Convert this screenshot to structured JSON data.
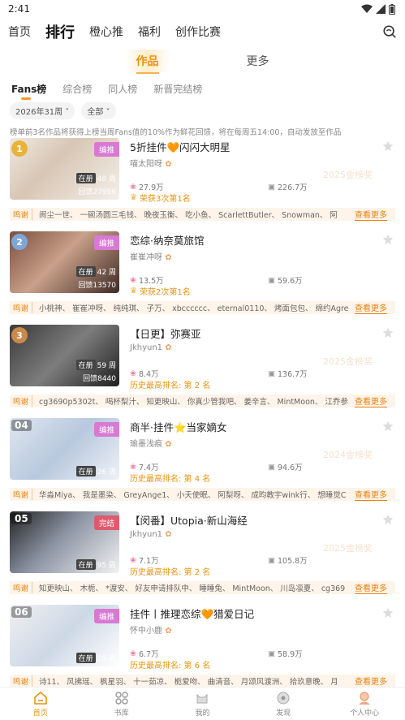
{
  "status": {
    "time": "2:41"
  },
  "nav": {
    "items": [
      "首页",
      "排行",
      "橙心推",
      "福利",
      "创作比赛"
    ],
    "active_index": 1
  },
  "sub_tabs": [
    "作品",
    "更多"
  ],
  "rank_tabs": [
    "Fans榜",
    "综合榜",
    "同人榜",
    "新晋完结榜"
  ],
  "filters": {
    "period": "2026年31周",
    "scope": "全部"
  },
  "notice": "榜单前3名作品将获得上榜当周Fans值的10%作为鲜花回馈，将在每周五14:00，自动发放至作品",
  "thanks_label": "鸣谢",
  "more_label": "查看更多",
  "works": [
    {
      "rank": "1",
      "title": "5折挂件🧡闪闪大明星",
      "author": "喵太阳呀",
      "tag": "编推",
      "shelf": "在册",
      "weeks": "48 周",
      "returns": "回馈27956",
      "fans": "27.9万",
      "collect": "226.7万",
      "honor": "荣获3次第1名",
      "watermark": "2025金榜奖",
      "thanks": "阆尘一世、 一碗汤圆三毛钱、 晚夜玉衡、 吃小鱼、 ScarlettButler、 Snowman、 阿"
    },
    {
      "rank": "2",
      "title": "恋综·纳奈莫旅馆",
      "author": "崔崔冲呀",
      "tag": "编推",
      "shelf": "在册",
      "weeks": "42 周",
      "returns": "回馈13570",
      "fans": "13.5万",
      "collect": "59.6万",
      "honor": "荣获2次第1名",
      "watermark": "",
      "thanks": "小桃神、 崔崔冲呀、 纯纯琪、 子万、 xbcccccc、 eternal0110、 烤面包包、 绵约Agre"
    },
    {
      "rank": "3",
      "title": "【日更】弥赛亚",
      "author": "Jkhyun1",
      "tag": "",
      "shelf": "在册",
      "weeks": "59 周",
      "returns": "回馈8440",
      "fans": "8.4万",
      "collect": "136.7万",
      "honor": "历史最高排名: 第 2 名",
      "watermark": "2025金榜奖",
      "thanks": "cg3690p5302t、 喝杯梨汁、 知更映山、 你真少管我吧、 姜辛言、 MintMoon、 江乔参"
    },
    {
      "rank": "04",
      "title": "商半·挂件⭐当家嫡女",
      "author": "瑜墨浅痕",
      "tag": "编推",
      "shelf": "在册",
      "weeks": "26 周",
      "returns": "",
      "fans": "7.4万",
      "collect": "94.6万",
      "honor": "历史最高排名: 第 4 名",
      "watermark": "2024金榜奖",
      "thanks": "华淼Miya、 我是墨染、 GreyAnge1、 小夭使眠、 阿梨呀、 成昀教宇wink行、 想睡觉C"
    },
    {
      "rank": "05",
      "title": "【闵番】Utopia·新山海经",
      "author": "Jkhyun1",
      "tag": "完结",
      "shelf": "在册",
      "weeks": "95 周",
      "returns": "",
      "fans": "7.1万",
      "collect": "105.8万",
      "honor": "历史最高排名: 第 2 名",
      "watermark": "2025金榜奖",
      "thanks": "知更映山、 木栀、 *渡安、 好友申请排队中、 睡睡兔、 MintMoon、 川岛凛夏、 cg369"
    },
    {
      "rank": "06",
      "title": "挂件丨推理恋综🧡猎爱日记",
      "author": "怀中小鹿",
      "tag": "编推",
      "shelf": "在册",
      "weeks": "29 周",
      "returns": "",
      "fans": "6.7万",
      "collect": "58.9万",
      "honor": "历史最高排名: 第 6 名",
      "watermark": "",
      "thanks": "诗11、 风拂瑶、 枫星羽、 十一茹凉、 栀爱吻、 曲清音、 月颂风渡洲、 拾玖意晚、 月"
    }
  ],
  "bottom_nav": [
    "首页",
    "书库",
    "我的",
    "发现",
    "个人中心"
  ],
  "colors": {
    "accent": "#e8930e",
    "tag_pink": "#d979d3",
    "tag_red": "#e05a6e"
  }
}
